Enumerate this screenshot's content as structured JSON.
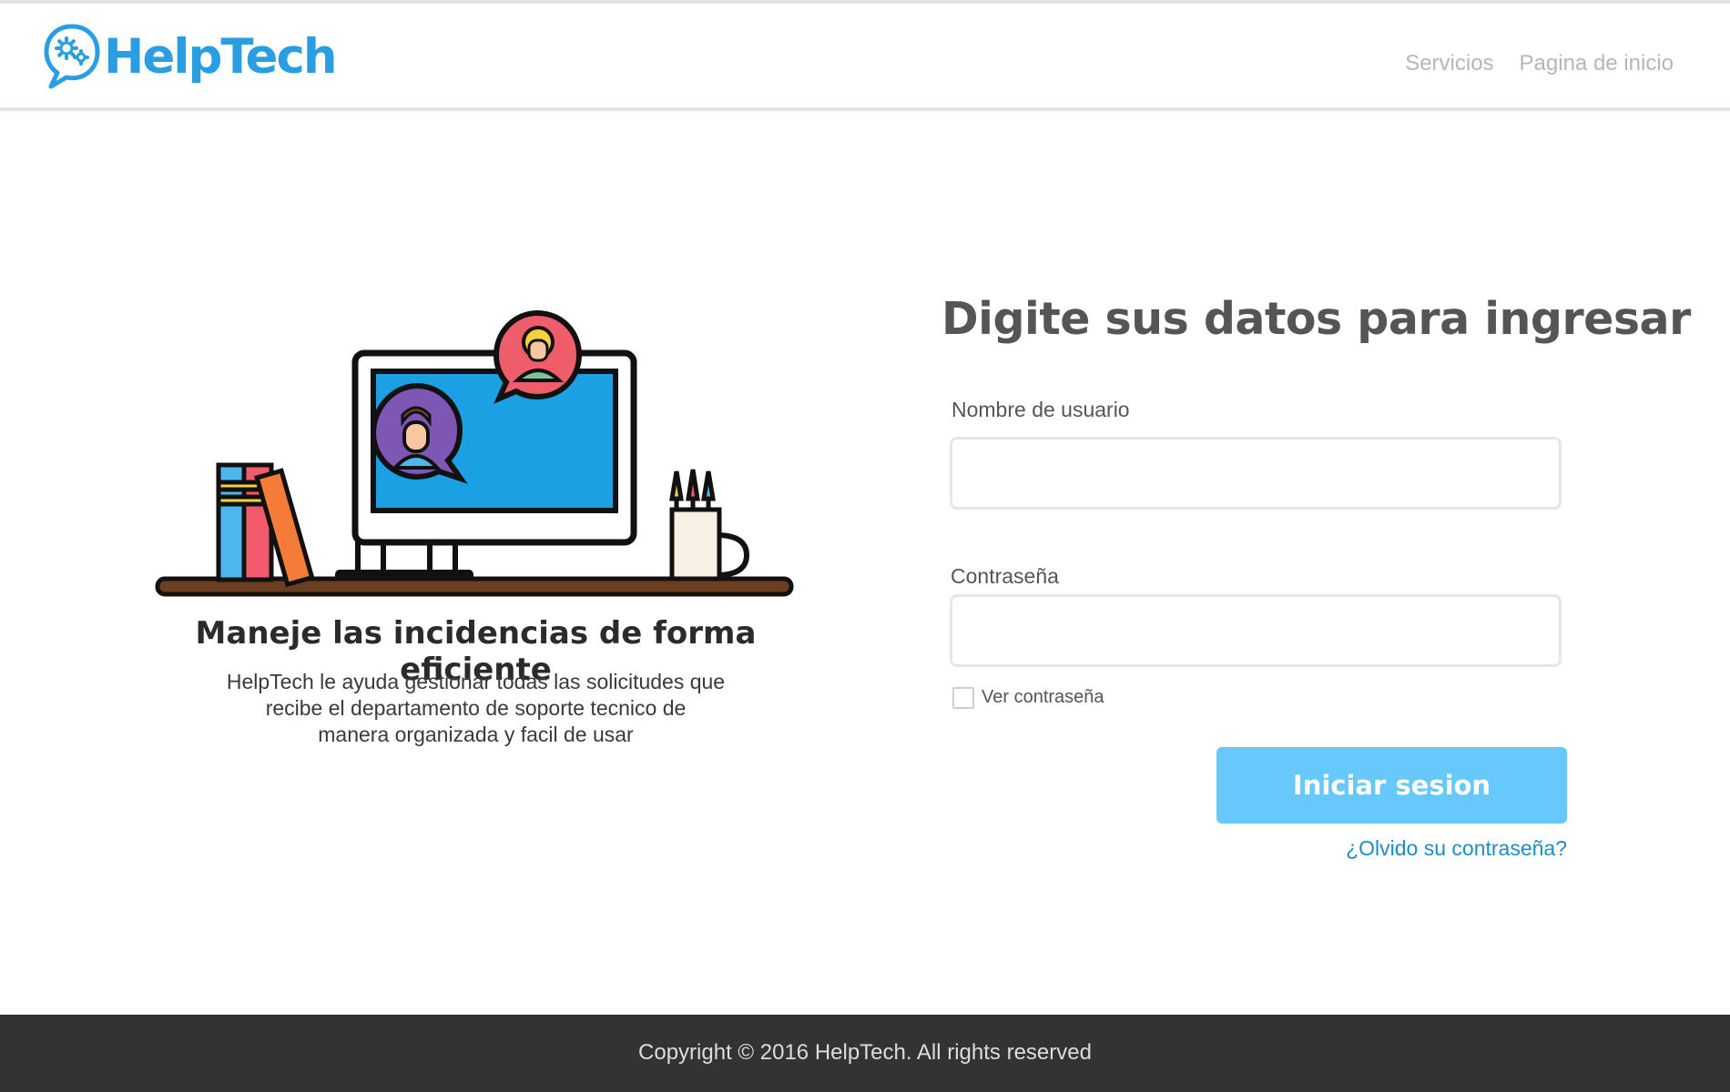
{
  "header": {
    "logo_text": "HelpTech",
    "nav": [
      "Servicios",
      "Pagina de inicio"
    ]
  },
  "promo": {
    "title": "Maneje las incidencias de forma eficiente",
    "lines": [
      "HelpTech le ayuda gestionar todas las solicitudes  que",
      "recibe el departamento de soporte tecnico de",
      "manera organizada y facil de usar"
    ]
  },
  "login": {
    "title": "Digite sus datos para ingresar",
    "username_label": "Nombre de usuario",
    "username_value": "",
    "password_label": "Contraseña",
    "password_value": "",
    "show_password_label": "Ver contraseña",
    "show_password_checked": false,
    "submit_label": "Iniciar sesion",
    "forgot_label": "¿Olvido su contraseña?"
  },
  "footer": {
    "text": "Copyright © 2016 HelpTech. All rights reserved"
  },
  "icons": {
    "logo": "chat-gears-icon",
    "illustration": "desk-computer-support-illustration"
  },
  "colors": {
    "brand": "#2a9ee2",
    "button": "#66c8fb",
    "link": "#1b8ec7",
    "footer": "#333333",
    "nav": "#b6b6b6"
  }
}
